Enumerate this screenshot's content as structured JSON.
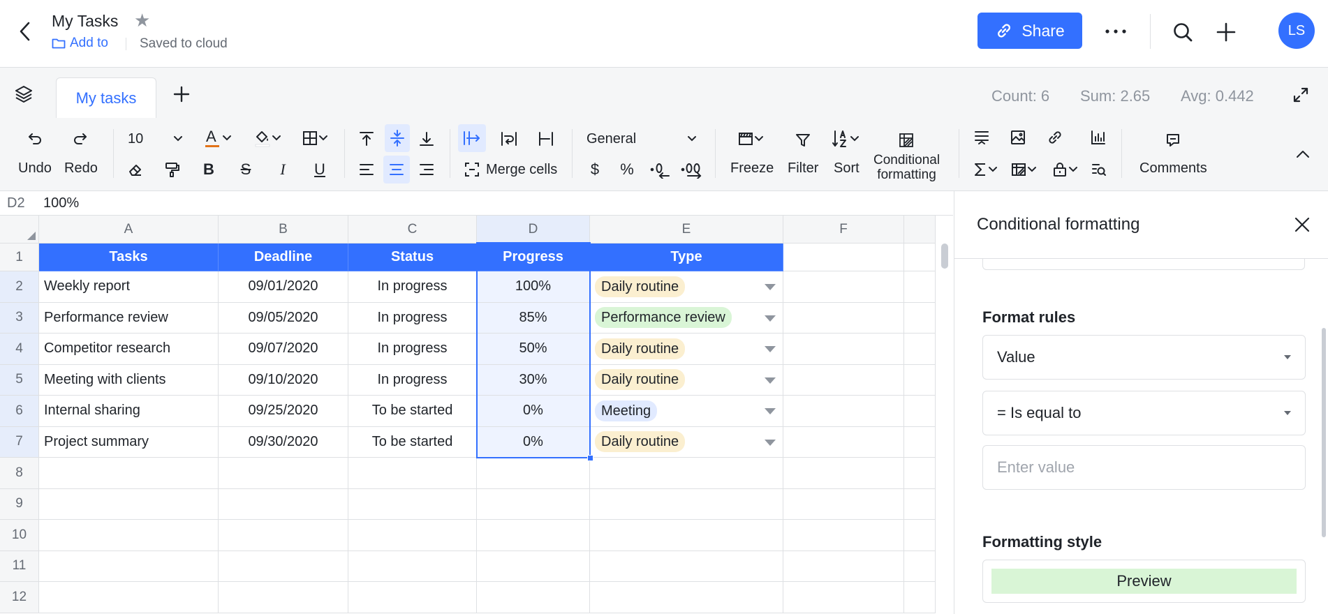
{
  "header": {
    "title": "My Tasks",
    "add_to": "Add to",
    "saved": "Saved to cloud",
    "share": "Share",
    "avatar_initials": "LS"
  },
  "tabs": {
    "sheet_tab": "My tasks"
  },
  "stats": {
    "count": "Count: 6",
    "sum": "Sum: 2.65",
    "avg": "Avg: 0.442"
  },
  "toolbar": {
    "undo": "Undo",
    "redo": "Redo",
    "font_size": "10",
    "merge_cells": "Merge cells",
    "number_format": "General",
    "currency": "$",
    "percent": "%",
    "freeze": "Freeze",
    "filter": "Filter",
    "sort": "Sort",
    "conditional_line1": "Conditional",
    "conditional_line2": "formatting",
    "comments": "Comments",
    "bold": "B",
    "strike": "S",
    "italic": "I",
    "underline": "U",
    "font_color_glyph": "A"
  },
  "formula_bar": {
    "cell_ref": "D2",
    "value": "100%"
  },
  "sheet": {
    "columns": [
      "A",
      "B",
      "C",
      "D",
      "E",
      "F"
    ],
    "row_numbers": [
      "1",
      "2",
      "3",
      "4",
      "5",
      "6",
      "7",
      "8",
      "9",
      "10",
      "11",
      "12"
    ],
    "headers": [
      "Tasks",
      "Deadline",
      "Status",
      "Progress",
      "Type"
    ],
    "rows": [
      {
        "task": "Weekly report",
        "deadline": "09/01/2020",
        "status": "In progress",
        "progress": "100%",
        "type": "Daily routine"
      },
      {
        "task": "Performance review",
        "deadline": "09/05/2020",
        "status": "In progress",
        "progress": "85%",
        "type": "Performance review"
      },
      {
        "task": "Competitor research",
        "deadline": "09/07/2020",
        "status": "In progress",
        "progress": "50%",
        "type": "Daily routine"
      },
      {
        "task": "Meeting with clients",
        "deadline": "09/10/2020",
        "status": "In progress",
        "progress": "30%",
        "type": "Daily routine"
      },
      {
        "task": "Internal sharing",
        "deadline": "09/25/2020",
        "status": "To be started",
        "progress": "0%",
        "type": "Meeting"
      },
      {
        "task": "Project summary",
        "deadline": "09/30/2020",
        "status": "To be started",
        "progress": "0%",
        "type": "Daily routine"
      }
    ],
    "chip_colors": {
      "Daily routine": "#fbefd0",
      "Performance review": "#d9f5d6",
      "Meeting": "#e1eaff"
    },
    "header_color": "#3370ff"
  },
  "panel": {
    "title": "Conditional formatting",
    "format_rules_title": "Format rules",
    "rule_type": "Value",
    "condition": "= Is equal to",
    "value_placeholder": "Enter value",
    "formatting_style_title": "Formatting style",
    "preview": "Preview"
  }
}
